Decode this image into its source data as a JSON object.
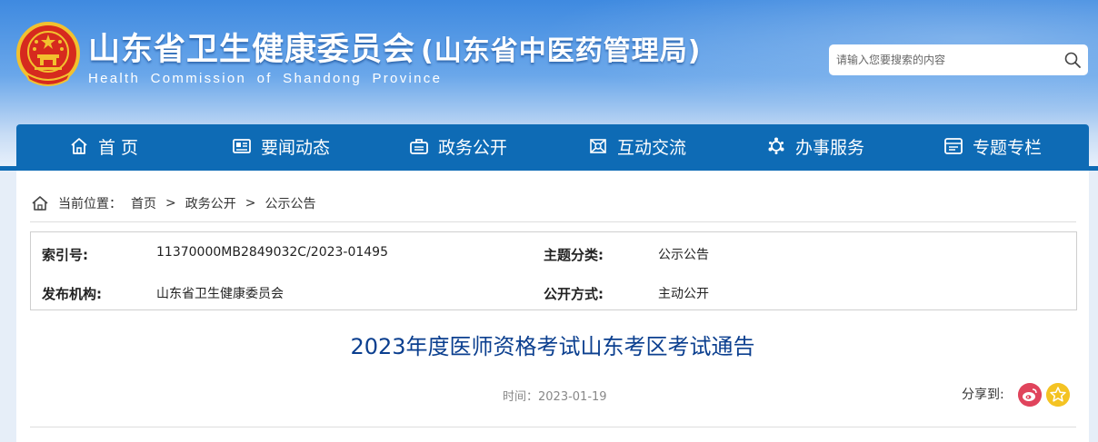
{
  "header": {
    "title": "山东省卫生健康委员会",
    "subtitle": "(山东省中医药管理局)",
    "title_en": "Health Commission of Shandong Province",
    "emblem_icon": "national-emblem-icon"
  },
  "search": {
    "placeholder": "请输入您要搜索的内容",
    "icon": "search-icon"
  },
  "nav": {
    "items": [
      {
        "label": "首 页",
        "icon": "home-icon"
      },
      {
        "label": "要闻动态",
        "icon": "news-icon"
      },
      {
        "label": "政务公开",
        "icon": "briefcase-icon"
      },
      {
        "label": "互动交流",
        "icon": "interaction-icon"
      },
      {
        "label": "办事服务",
        "icon": "service-icon"
      },
      {
        "label": "专题专栏",
        "icon": "topic-icon"
      }
    ]
  },
  "breadcrumb": {
    "prefix": "当前位置：",
    "items": [
      "首页",
      "政务公开",
      "公示公告"
    ],
    "separator": ">"
  },
  "meta": {
    "index_label": "索引号:",
    "index_value": "11370000MB2849032C/2023-01495",
    "topic_label": "主题分类:",
    "topic_value": "公示公告",
    "publisher_label": "发布机构:",
    "publisher_value": "山东省卫生健康委员会",
    "mode_label": "公开方式:",
    "mode_value": "主动公开"
  },
  "article": {
    "title": "2023年度医师资格考试山东考区考试通告",
    "time": "时间：2023-01-19"
  },
  "share": {
    "label": "分享到:",
    "icons": [
      "weibo-icon",
      "favorite-icon"
    ]
  },
  "colors": {
    "nav_bg": "#0e6bb5",
    "title_color": "#0b3f8f",
    "weibo": "#e0445c",
    "favorite": "#f4c323"
  }
}
